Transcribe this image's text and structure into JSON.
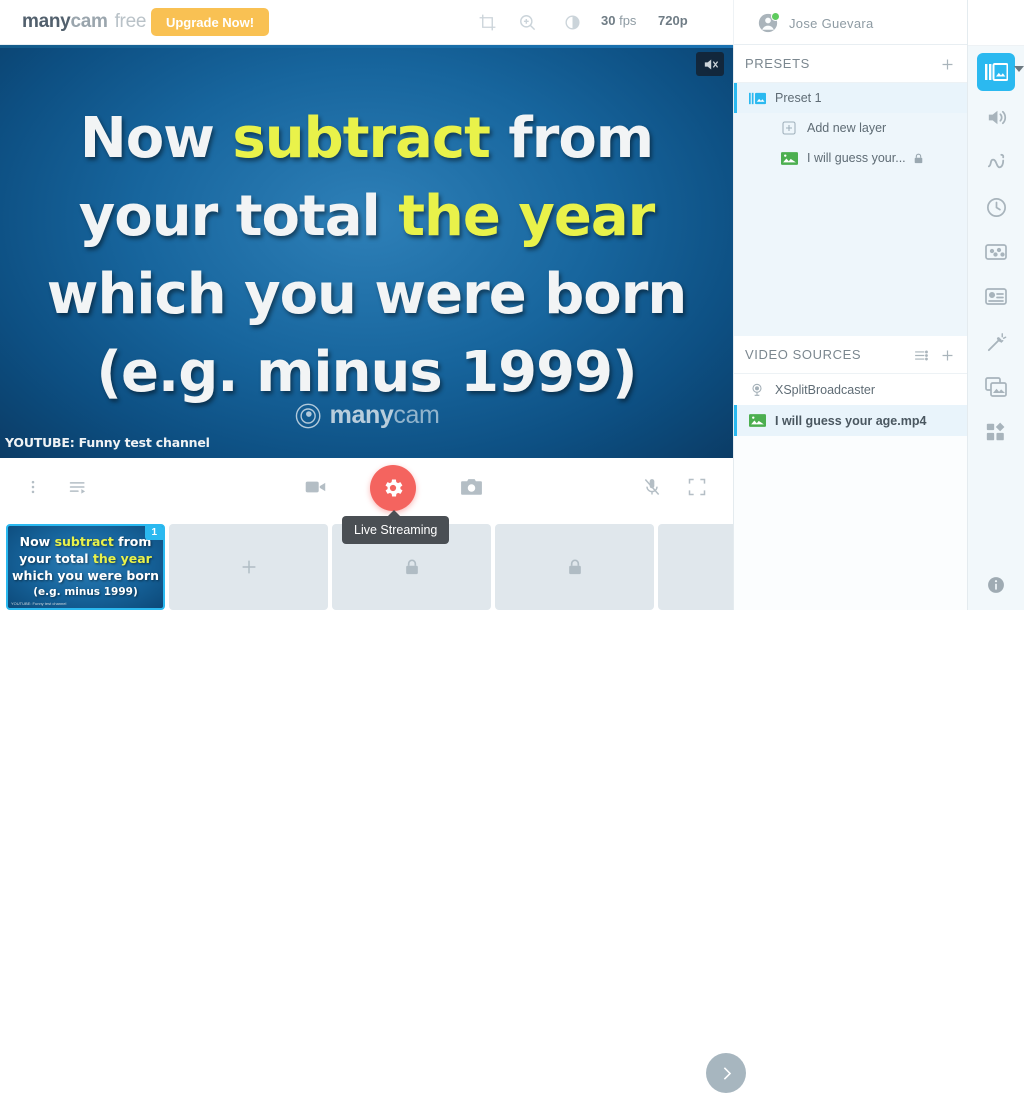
{
  "app": {
    "brand_bold": "many",
    "brand_mid": "cam",
    "brand_light": "free",
    "upgrade_label": "Upgrade Now!",
    "accent_blue": "#2bb9f0",
    "accent_yellow": "#f9c153",
    "accent_red": "#f4645f",
    "online_green": "#5ecb5e"
  },
  "topbar": {
    "icons": [
      {
        "name": "crop-icon",
        "glyph": "crop"
      },
      {
        "name": "zoom-in-icon",
        "glyph": "zoom"
      },
      {
        "name": "brightness-icon",
        "glyph": "brightness"
      }
    ],
    "fps_value": "30",
    "fps_unit": "fps",
    "resolution": "720p",
    "account_name": "Jose  Guevara",
    "settings_icon": "gear-icon"
  },
  "video": {
    "line1_a": "Now ",
    "line1_b": "subtract",
    "line1_c": " from",
    "line2_a": "your total ",
    "line2_b": "the year",
    "line3": "which you were born",
    "line4": "(e.g. minus 1999)",
    "watermark_bold": "many",
    "watermark_light": "cam",
    "youtube_watermark": "YOUTUBE: Funny test channel",
    "mute_icon": "mute-icon"
  },
  "controls": {
    "items": [
      {
        "name": "more-options-button",
        "icon": "kebab-menu-icon"
      },
      {
        "name": "playlist-button",
        "icon": "playlist-icon"
      },
      {
        "name": "record-video-button",
        "icon": "video-camera-icon"
      },
      {
        "name": "snapshot-button",
        "icon": "photo-camera-icon"
      },
      {
        "name": "microphone-button",
        "icon": "microphone-muted-icon"
      },
      {
        "name": "fullscreen-button",
        "icon": "fullscreen-icon"
      }
    ],
    "live_streaming_icon": "gear-icon",
    "tooltip": "Live Streaming"
  },
  "thumbnails": {
    "active_badge": "1",
    "active_line1_a": "Now ",
    "active_line1_b": "subtract",
    "active_line1_c": " from",
    "active_line2_a": "your total ",
    "active_line2_b": "the year",
    "active_line3": "which you were born",
    "active_line4": "(e.g. minus 1999)",
    "active_watermark": "YOUTUBE: Funny test channel",
    "add_icon": "plus-icon",
    "locked_icon": "lock-icon",
    "next_icon": "chevron-right-icon"
  },
  "presets": {
    "title": "PRESETS",
    "add_icon": "plus-icon",
    "items": [
      {
        "label": "Preset 1",
        "icon": "preset-layers-icon",
        "selected": true
      },
      {
        "label": "Add new layer",
        "icon": "add-box-icon",
        "selected": false
      },
      {
        "label": "I will guess your...",
        "icon": "image-layer-icon",
        "selected": false,
        "locked": true
      }
    ]
  },
  "video_sources": {
    "title": "VIDEO SOURCES",
    "settings_icon": "sliders-icon",
    "add_icon": "plus-icon",
    "items": [
      {
        "label": "XSplitBroadcaster",
        "icon": "webcam-icon",
        "selected": false
      },
      {
        "label": "I will guess your age.mp4",
        "icon": "image-layer-icon",
        "selected": true
      }
    ]
  },
  "rail": {
    "top_icon": "gear-icon",
    "items": [
      {
        "name": "rail-presets",
        "icon": "presets-icon",
        "active": true
      },
      {
        "name": "rail-audio",
        "icon": "speaker-icon",
        "active": false
      },
      {
        "name": "rail-draw",
        "icon": "draw-icon",
        "active": false
      },
      {
        "name": "rail-history",
        "icon": "clock-icon",
        "active": false
      },
      {
        "name": "rail-masks",
        "icon": "masks-icon",
        "active": false
      },
      {
        "name": "rail-lower-third",
        "icon": "lower-third-icon",
        "active": false
      },
      {
        "name": "rail-effects",
        "icon": "magic-wand-icon",
        "active": false
      },
      {
        "name": "rail-backgrounds",
        "icon": "images-icon",
        "active": false
      },
      {
        "name": "rail-widgets",
        "icon": "grid-icon",
        "active": false
      }
    ],
    "info_icon": "info-icon"
  }
}
